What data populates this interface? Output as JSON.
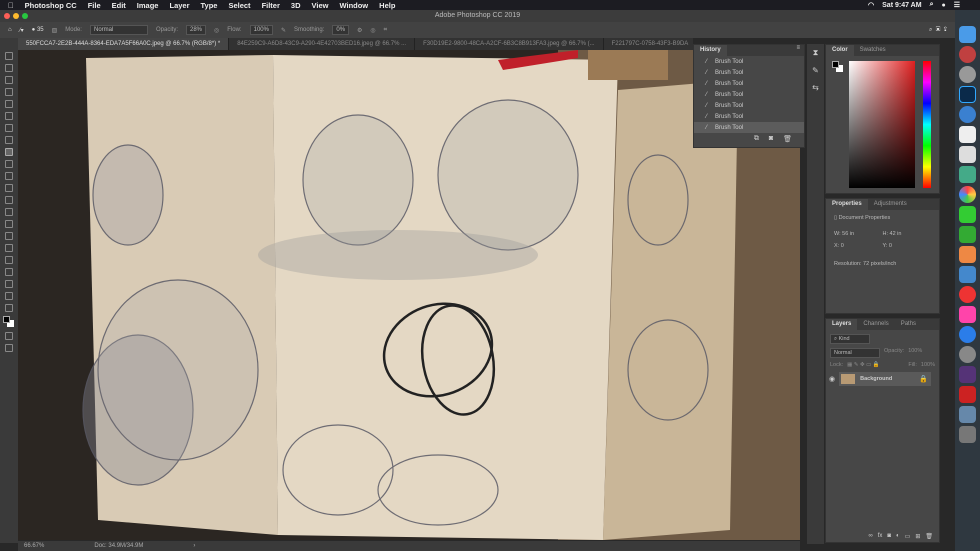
{
  "menubar": {
    "app": "Photoshop CC",
    "items": [
      "File",
      "Edit",
      "Image",
      "Layer",
      "Type",
      "Select",
      "Filter",
      "3D",
      "View",
      "Window",
      "Help"
    ],
    "clock": "Sat 9:47 AM"
  },
  "window": {
    "title": "Adobe Photoshop CC 2019"
  },
  "options": {
    "brush_size": "35",
    "mode_label": "Mode:",
    "mode": "Normal",
    "opacity_label": "Opacity:",
    "opacity": "28%",
    "flow_label": "Flow:",
    "flow": "100%",
    "smoothing_label": "Smoothing:",
    "smoothing": "0%"
  },
  "tabs": [
    "550FCCA7-2E2B-444A-8364-EDA7A5F66A0C.jpeg @ 66.7% (RGB/8*) *",
    "84E259C9-A6D8-43C9-A290-4E42703BED16.jpeg @ 66.7% ...",
    "F30D19E2-9800-48CA-A2CF-6B3C8B913FA3.jpeg @ 66.7% (...",
    "F221797C-0758-43F3-B9DA"
  ],
  "history": {
    "title": "History",
    "items": [
      "Brush Tool",
      "Brush Tool",
      "Brush Tool",
      "Brush Tool",
      "Brush Tool",
      "Brush Tool",
      "Brush Tool"
    ]
  },
  "color": {
    "tabs": [
      "Color",
      "Swatches"
    ],
    "foreground": "#000000",
    "background": "#ffffff",
    "hue": "#e02020"
  },
  "properties": {
    "tabs": [
      "Properties",
      "Adjustments"
    ],
    "heading": "Document Properties",
    "w": "W: 56 in",
    "h": "H: 42 in",
    "x": "X: 0",
    "y": "Y: 0",
    "resolution": "Resolution: 72 pixels/inch"
  },
  "layers": {
    "tabs": [
      "Layers",
      "Channels",
      "Paths"
    ],
    "filter": "Kind",
    "blend": "Normal",
    "opacity_label": "Opacity:",
    "opacity": "100%",
    "lock_label": "Lock:",
    "fill_label": "Fill:",
    "fill": "100%",
    "layer": "Background"
  },
  "status": {
    "zoom": "66.67%",
    "doc": "Doc: 34.9M/34.9M"
  }
}
